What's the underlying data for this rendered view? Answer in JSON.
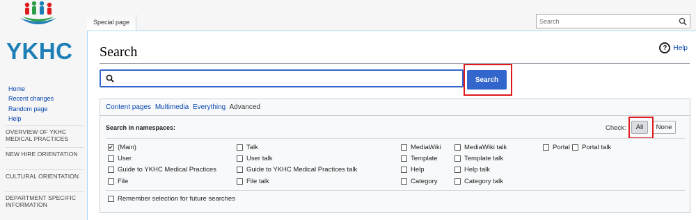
{
  "app": {
    "logo_text": "YKHC"
  },
  "sidebar": {
    "nav": [
      "Home",
      "Recent changes",
      "Random page",
      "Help"
    ],
    "portals": [
      "OVERVIEW OF YKHC MEDICAL PRACTICES",
      "NEW HIRE ORIENTATION",
      "CULTURAL ORIENTATION",
      "DEPARTMENT SPECIFIC INFORMATION"
    ]
  },
  "header": {
    "tab_label": "Special page",
    "search_placeholder": "Search",
    "search_icon": "magnifier-icon"
  },
  "page": {
    "title": "Search",
    "help_label": "Help",
    "search_value": "",
    "search_button": "Search",
    "profile_tabs": [
      {
        "label": "Content pages",
        "active": false
      },
      {
        "label": "Multimedia",
        "active": false
      },
      {
        "label": "Everything",
        "active": false
      },
      {
        "label": "Advanced",
        "active": true
      }
    ],
    "namespaces_label": "Search in namespaces:",
    "check_label": "Check:",
    "check_all": "All",
    "check_none": "None",
    "namespaces": [
      {
        "label": "(Main)",
        "checked": true
      },
      {
        "label": "User",
        "checked": false
      },
      {
        "label": "Guide to YKHC Medical Practices",
        "checked": false
      },
      {
        "label": "File",
        "checked": false
      },
      {
        "label": "Talk",
        "checked": false
      },
      {
        "label": "User talk",
        "checked": false
      },
      {
        "label": "Guide to YKHC Medical Practices talk",
        "checked": false
      },
      {
        "label": "File talk",
        "checked": false
      },
      {
        "label": "MediaWiki",
        "checked": false
      },
      {
        "label": "Template",
        "checked": false
      },
      {
        "label": "Help",
        "checked": false
      },
      {
        "label": "Category",
        "checked": false
      },
      {
        "label": "MediaWiki talk",
        "checked": false
      },
      {
        "label": "Template talk",
        "checked": false
      },
      {
        "label": "Help talk",
        "checked": false
      },
      {
        "label": "Category talk",
        "checked": false
      },
      {
        "label": "Portal",
        "checked": false
      },
      {
        "label": "Portal talk",
        "checked": false
      }
    ],
    "remember_label": "Remember selection for future searches",
    "remember_checked": false
  },
  "colors": {
    "accent": "#3366cc",
    "link": "#0645ad",
    "highlight": "#e0191d",
    "logo_blue": "#1f80b8",
    "logo_green": "#2e9e4a"
  }
}
